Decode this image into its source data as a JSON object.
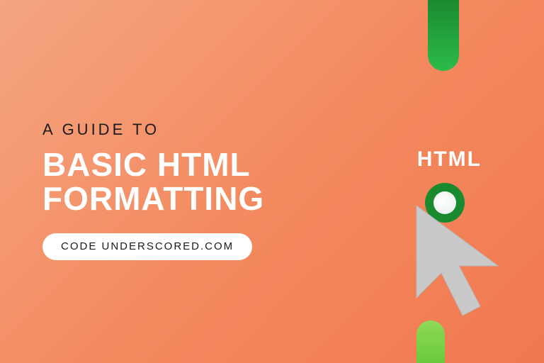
{
  "kicker": "A GUIDE TO",
  "headline_line1": "BASIC HTML",
  "headline_line2": "FORMATTING",
  "pill_text": "CODE UNDERSCORED.COM",
  "badge_label": "HTML",
  "colors": {
    "bg_start": "#f4a582",
    "bg_end": "#f07850",
    "accent_green_dark": "#1a8a2e",
    "accent_green_light": "#8ed957",
    "text_dark": "#1a1a1a",
    "text_light": "#ffffff",
    "cursor_fill": "#c9c9c9"
  }
}
